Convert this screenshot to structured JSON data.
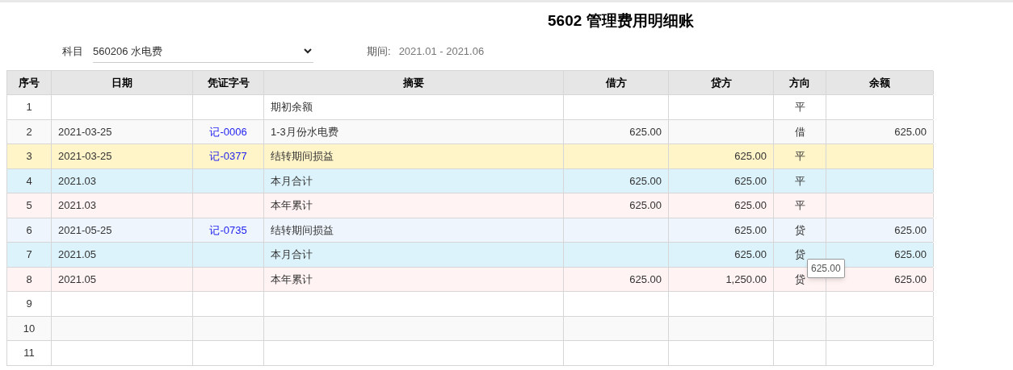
{
  "title": "5602 管理费用明细账",
  "filters": {
    "subject_label": "科目",
    "subject_value": "560206 水电费",
    "period_label": "期间:",
    "period_value": "2021.01 - 2021.06"
  },
  "table": {
    "columns": [
      "序号",
      "日期",
      "凭证字号",
      "摘要",
      "借方",
      "贷方",
      "方向",
      "余额"
    ],
    "rows": [
      {
        "kind": "opening",
        "selected": false,
        "no": "1",
        "date": "",
        "voucher": "",
        "summary": "期初余额",
        "debit": "",
        "credit": "",
        "direction": "平",
        "balance": ""
      },
      {
        "kind": "entry",
        "selected": false,
        "no": "2",
        "date": "2021-03-25",
        "voucher": "记-0006",
        "summary": "1-3月份水电费",
        "debit": "625.00",
        "credit": "",
        "direction": "借",
        "balance": "625.00"
      },
      {
        "kind": "transfer",
        "selected": true,
        "no": "3",
        "date": "2021-03-25",
        "voucher": "记-0377",
        "summary": "结转期间损益",
        "debit": "",
        "credit": "625.00",
        "direction": "平",
        "balance": ""
      },
      {
        "kind": "month_total",
        "selected": false,
        "no": "4",
        "date": "2021.03",
        "voucher": "",
        "summary": "本月合计",
        "debit": "625.00",
        "credit": "625.00",
        "direction": "平",
        "balance": ""
      },
      {
        "kind": "year_total",
        "selected": false,
        "no": "5",
        "date": "2021.03",
        "voucher": "",
        "summary": "本年累计",
        "debit": "625.00",
        "credit": "625.00",
        "direction": "平",
        "balance": ""
      },
      {
        "kind": "transfer",
        "selected": false,
        "no": "6",
        "date": "2021-05-25",
        "voucher": "记-0735",
        "summary": "结转期间损益",
        "debit": "",
        "credit": "625.00",
        "direction": "贷",
        "balance": "625.00"
      },
      {
        "kind": "month_total",
        "selected": false,
        "no": "7",
        "date": "2021.05",
        "voucher": "",
        "summary": "本月合计",
        "debit": "",
        "credit": "625.00",
        "direction": "贷",
        "balance": "625.00"
      },
      {
        "kind": "year_total",
        "selected": false,
        "no": "8",
        "date": "2021.05",
        "voucher": "",
        "summary": "本年累计",
        "debit": "625.00",
        "credit": "1,250.00",
        "direction": "贷",
        "balance": "625.00"
      },
      {
        "kind": "blank",
        "selected": false,
        "no": "9"
      },
      {
        "kind": "blank",
        "selected": false,
        "no": "10"
      },
      {
        "kind": "blank",
        "selected": false,
        "no": "11"
      }
    ]
  },
  "tooltip": {
    "text": "625.00"
  }
}
